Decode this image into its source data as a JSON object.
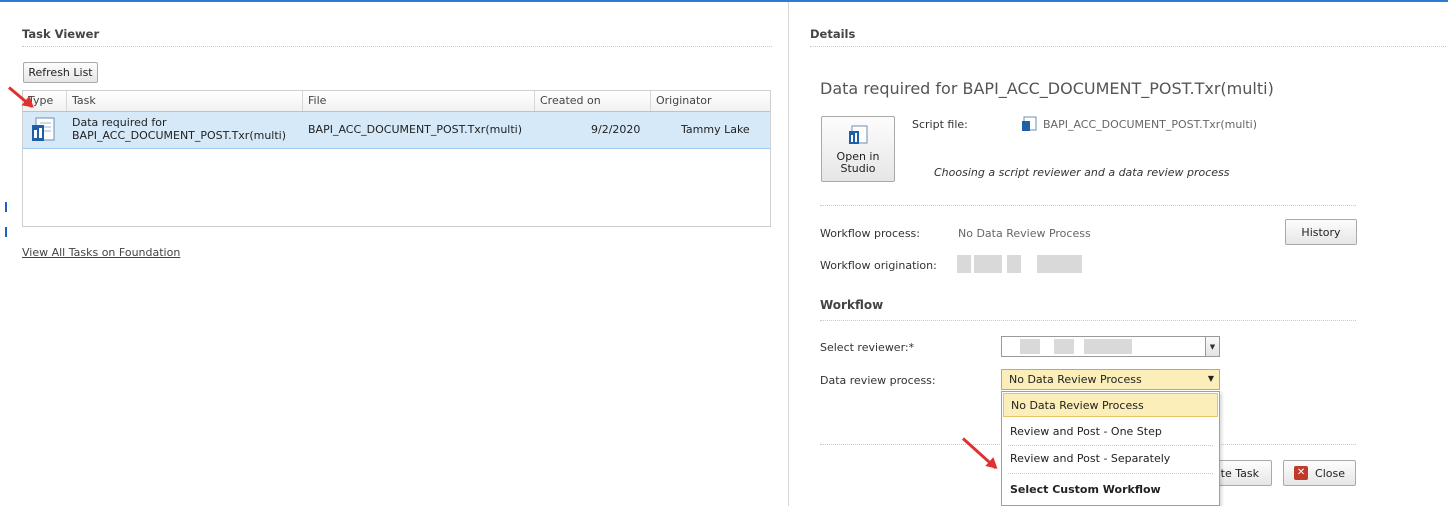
{
  "left_panel": {
    "title": "Task Viewer",
    "refresh_label": "Refresh List",
    "columns": [
      "Type",
      "Task",
      "File",
      "Created on",
      "Originator"
    ],
    "row": {
      "task_line1": "Data required for",
      "task_line2": "BAPI_ACC_DOCUMENT_POST.Txr(multi)",
      "file": "BAPI_ACC_DOCUMENT_POST.Txr(multi)",
      "created_on": "9/2/2020",
      "originator": "Tammy Lake"
    },
    "view_all_link": "View All Tasks on Foundation"
  },
  "right_panel": {
    "title": "Details",
    "heading": "Data required for BAPI_ACC_DOCUMENT_POST.Txr(multi)",
    "open_in_label1": "Open in",
    "open_in_label2": "Studio",
    "script_file_label": "Script file:",
    "script_file_value": "BAPI_ACC_DOCUMENT_POST.Txr(multi)",
    "description": "Choosing a script reviewer and a data review process",
    "workflow_process_label": "Workflow process:",
    "workflow_process_value": "No Data Review Process",
    "history_label": "History",
    "workflow_origination_label": "Workflow origination:",
    "workflow_section_title": "Workflow",
    "select_reviewer_label": "Select reviewer:*",
    "data_review_label": "Data review process:",
    "data_review_value": "No Data Review Process",
    "dropdown_options": [
      "No Data Review Process",
      "Review and Post - One Step",
      "Review and Post - Separately",
      "Select Custom Workflow"
    ],
    "complete_task_partial": "ete Task",
    "close_label": "Close"
  },
  "colors": {
    "accent": "#2b7bd1",
    "selection": "#d6e9f8",
    "highlight": "#fbeeb8",
    "annotation_arrow": "#e03030"
  }
}
